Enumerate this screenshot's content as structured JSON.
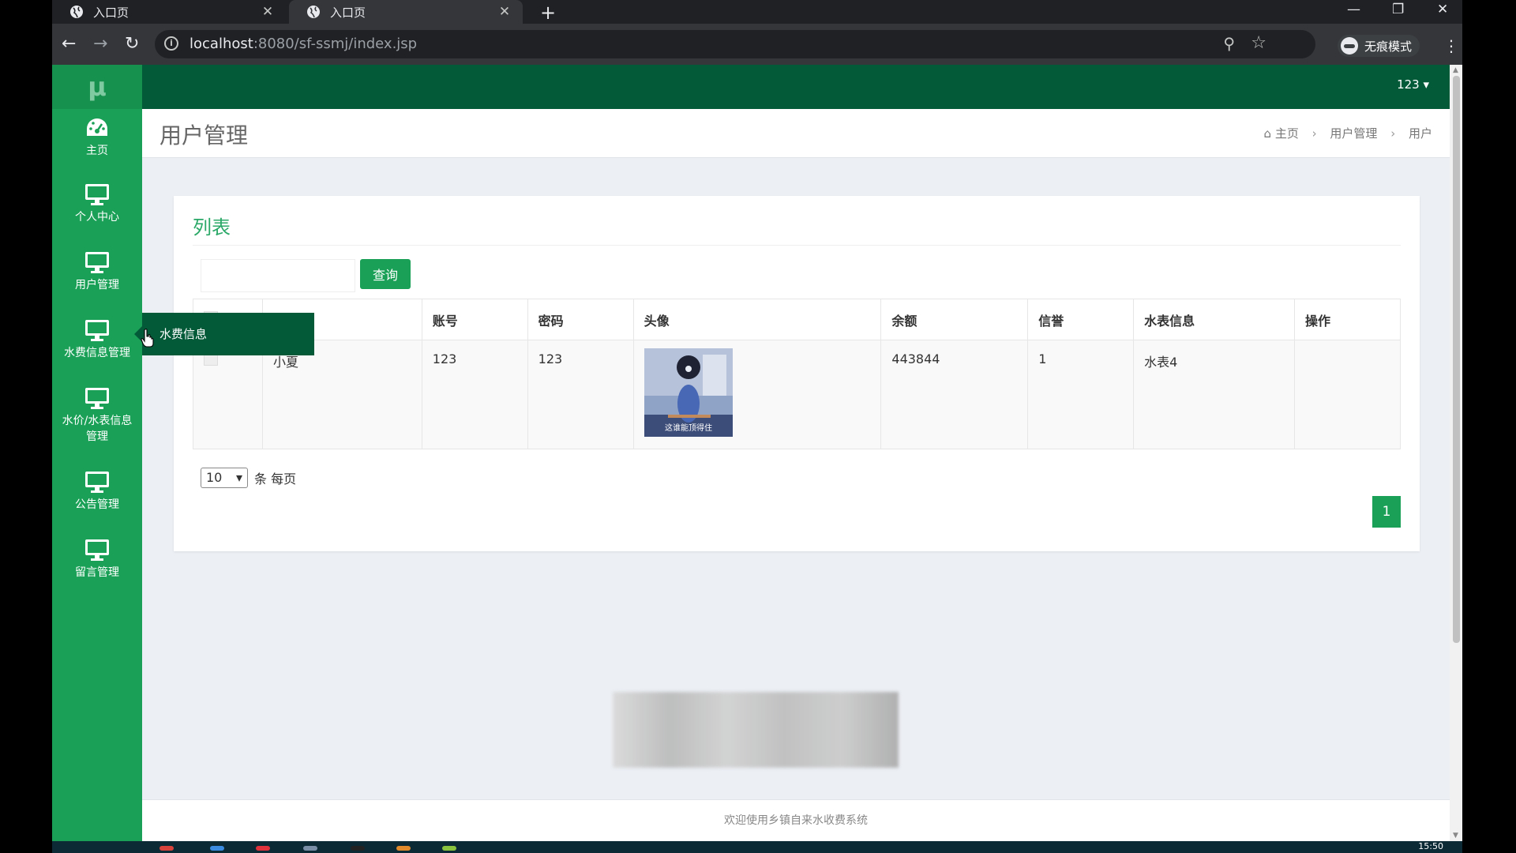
{
  "browser": {
    "tabs": [
      {
        "title": "入口页"
      },
      {
        "title": "入口页"
      }
    ],
    "url_host": "localhost",
    "url_rest": ":8080/sf-ssmj/index.jsp",
    "incognito_label": "无痕模式"
  },
  "app": {
    "logo": "μ",
    "user_menu": "123 ▾",
    "sidebar": {
      "items": [
        {
          "label": "主页",
          "icon": "dashboard-icon"
        },
        {
          "label": "个人中心",
          "icon": "monitor-icon"
        },
        {
          "label": "用户管理",
          "icon": "monitor-icon"
        },
        {
          "label": "水费信息管理",
          "icon": "monitor-icon"
        },
        {
          "label": "水价/水表信息",
          "label2": "管理",
          "icon": "monitor-icon"
        },
        {
          "label": "公告管理",
          "icon": "monitor-icon"
        },
        {
          "label": "留言管理",
          "icon": "monitor-icon"
        }
      ],
      "submenu_label": "水费信息"
    },
    "page_title": "用户管理",
    "breadcrumb": [
      "主页",
      "用户管理",
      "用户"
    ],
    "list": {
      "title": "列表",
      "search_placeholder": "",
      "query_button": "查询",
      "columns": [
        "",
        "称",
        "账号",
        "密码",
        "头像",
        "余额",
        "信誉",
        "水表信息",
        "操作"
      ],
      "rows": [
        {
          "name": "小夏",
          "account": "123",
          "password": "123",
          "avatar_caption": "这谁能顶得住",
          "balance": "443844",
          "credit": "1",
          "meter": "水表4",
          "ops": ""
        }
      ],
      "page_size": "10",
      "page_size_suffix": "条 每页",
      "current_page": "1"
    },
    "footer": "欢迎使用乡镇自来水收费系统"
  },
  "taskbar": {
    "clock": "15:50"
  },
  "colors": {
    "sidebar": "#1aa157",
    "topbar": "#035a39",
    "accent": "#1aa157"
  }
}
